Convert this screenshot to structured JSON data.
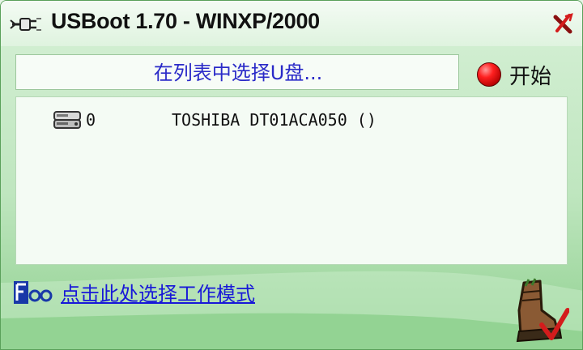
{
  "window": {
    "title": "USBoot 1.70 - WINXP/2000",
    "icons": {
      "app": "usb-plug-icon",
      "close": "close-icon"
    }
  },
  "status": {
    "message": "在列表中选择U盘..."
  },
  "start_button": {
    "label": "开始",
    "icon": "red-record-icon"
  },
  "devices": [
    {
      "index": "0",
      "name": "TOSHIBA DT01ACA050 ()",
      "icon": "hard-drive-icon"
    }
  ],
  "footer": {
    "mode_link": "点击此处选择工作模式",
    "logo_icon": "foo-logo-icon",
    "boot_icon": "boot-checkmark-icon"
  },
  "colors": {
    "accent_green": "#8fd08f",
    "link_blue": "#1818d8",
    "status_blue": "#2a2ac8",
    "close_red": "#c01818"
  }
}
